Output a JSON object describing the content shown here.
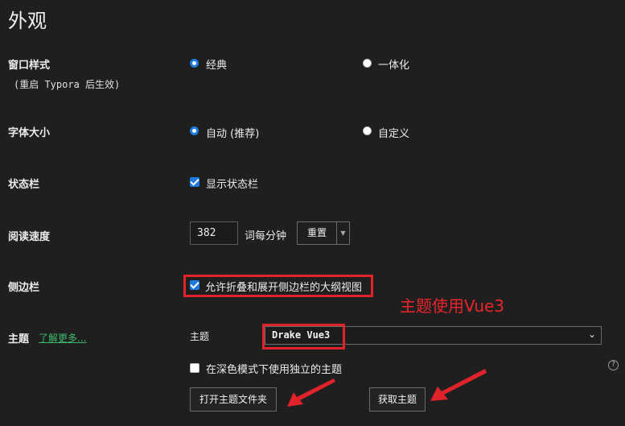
{
  "page": {
    "title": "外观"
  },
  "window_style": {
    "label": "窗口样式",
    "note": "(重启 Typora 后生效)",
    "options": [
      {
        "label": "经典",
        "selected": true
      },
      {
        "label": "一体化",
        "selected": false
      }
    ]
  },
  "font_size": {
    "label": "字体大小",
    "options": [
      {
        "label": "自动 (推荐)",
        "selected": true
      },
      {
        "label": "自定义",
        "selected": false
      }
    ]
  },
  "status_bar": {
    "label": "状态栏",
    "checkbox_label": "显示状态栏",
    "checked": true
  },
  "reading_speed": {
    "label": "阅读速度",
    "value": "382",
    "unit": "词每分钟",
    "reset_label": "重置"
  },
  "sidebar": {
    "label": "侧边栏",
    "checkbox_label": "允许折叠和展开侧边栏的大纲视图",
    "checked": true
  },
  "theme": {
    "label": "主题",
    "learn_more": "了解更多...",
    "field_label": "主题",
    "selected": "Drake Vue3",
    "dark_mode_label": "在深色模式下使用独立的主题",
    "dark_mode_checked": false,
    "open_folder_button": "打开主题文件夹",
    "get_themes_button": "获取主题",
    "help": "?"
  },
  "annotation": {
    "text": "主题使用Vue3",
    "color": "#e9242b"
  },
  "colors": {
    "accent": "#1e7be0",
    "background": "#1f1f1f",
    "link": "#3fba6c",
    "highlight": "#e0232b"
  }
}
